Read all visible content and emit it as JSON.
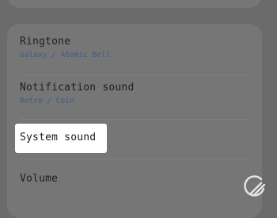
{
  "settings": {
    "items": [
      {
        "title": "Ringtone",
        "subtitle": "Galaxy / Atomic Bell"
      },
      {
        "title": "Notification sound",
        "subtitle": "Retro / Coin"
      },
      {
        "title": "System sound"
      },
      {
        "title": "Volume"
      }
    ]
  },
  "colors": {
    "background": "#6b6b6b",
    "card": "#767676",
    "subtitle_accent": "#3b5a8a",
    "highlight": "#ffffff"
  },
  "icons": {
    "watermark": "brand-logo-icon"
  }
}
